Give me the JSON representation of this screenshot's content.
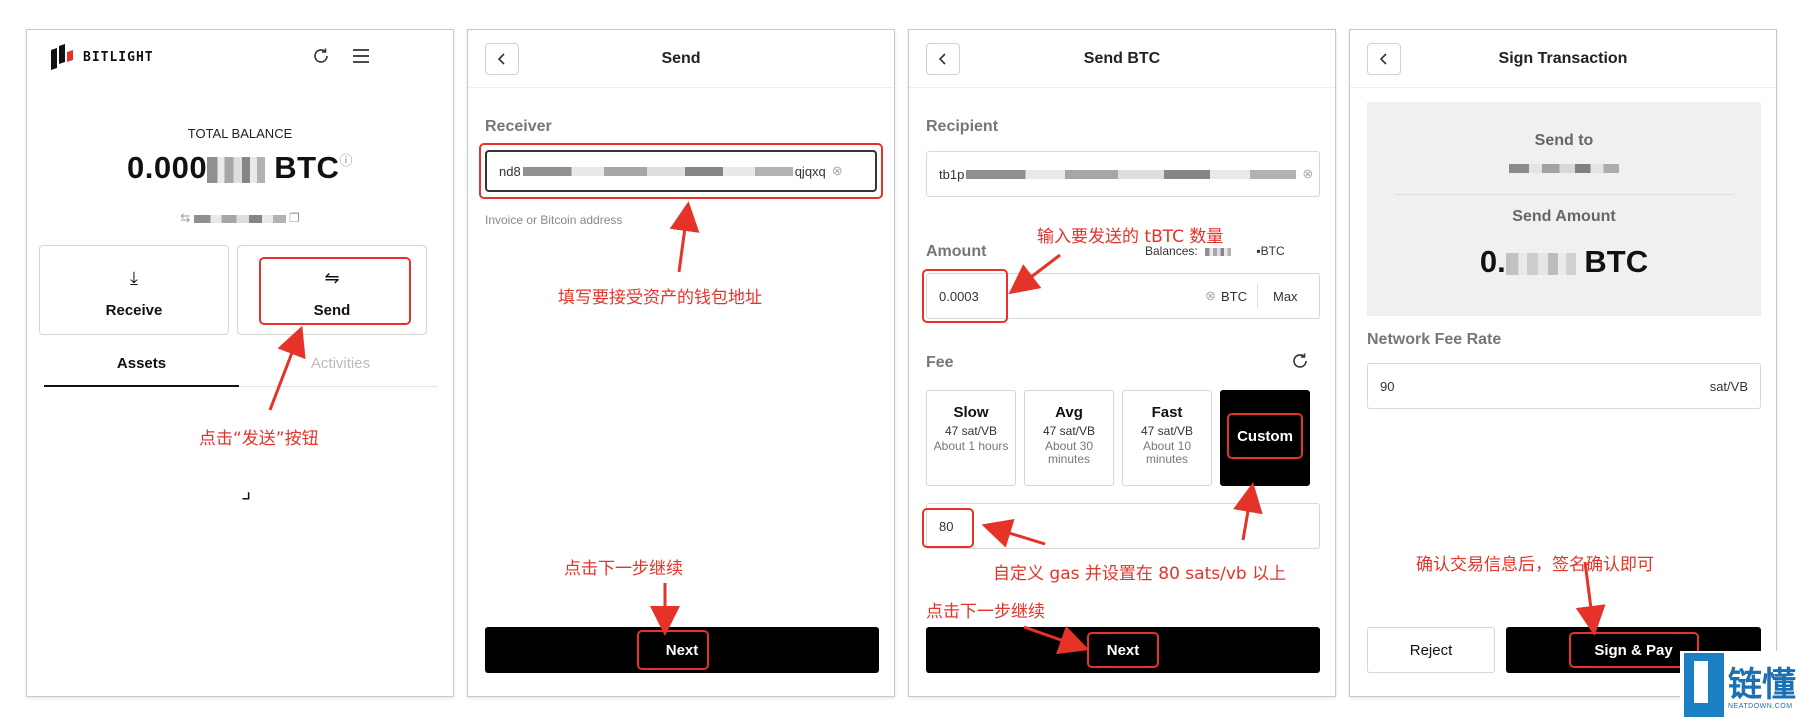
{
  "screen1": {
    "brand": "BITLIGHT",
    "total_label": "TOTAL BALANCE",
    "balance_prefix": "0.000",
    "balance_unit": "BTC",
    "receive_label": "Receive",
    "send_label": "Send",
    "tab_assets": "Assets",
    "tab_activities": "Activities",
    "annotation": "点击“发送”按钮"
  },
  "screen2": {
    "title": "Send",
    "receiver_label": "Receiver",
    "receiver_value_start": "nd8",
    "receiver_value_end": "qjqxq",
    "receiver_hint": "Invoice or Bitcoin address",
    "next_label": "Next",
    "annotation_receiver": "填写要接受资产的钱包地址",
    "annotation_next": "点击下一步继续"
  },
  "screen3": {
    "title": "Send BTC",
    "recipient_label": "Recipient",
    "recipient_value_start": "tb1p",
    "amount_label": "Amount",
    "balances_label": "Balances:",
    "balances_unit": "BTC",
    "amount_value": "0.0003",
    "amount_unit": "BTC",
    "max_label": "Max",
    "fee_label": "Fee",
    "fees": [
      {
        "name": "Slow",
        "rate": "47 sat/VB",
        "time": "About 1 hours"
      },
      {
        "name": "Avg",
        "rate": "47 sat/VB",
        "time": "About 30 minutes"
      },
      {
        "name": "Fast",
        "rate": "47 sat/VB",
        "time": "About 10 minutes"
      }
    ],
    "custom_label": "Custom",
    "custom_fee_value": "80",
    "next_label": "Next",
    "annotation_amount": "输入要发送的 tBTC 数量",
    "annotation_gas": "自定义 gas 并设置在 80 sats/vb 以上",
    "annotation_next": "点击下一步继续"
  },
  "screen4": {
    "title": "Sign Transaction",
    "send_to_label": "Send to",
    "send_amount_label": "Send Amount",
    "amount_prefix": "0.",
    "amount_unit": "BTC",
    "fee_rate_label": "Network Fee Rate",
    "fee_rate_value": "90",
    "fee_rate_unit": "sat/VB",
    "reject_label": "Reject",
    "sign_label": "Sign & Pay",
    "annotation": "确认交易信息后，签名确认即可"
  },
  "watermark": {
    "text": "链懂",
    "sub": "NEATDOWN.COM"
  },
  "colors": {
    "annotation_red": "#e5332a",
    "primary_button": "#000000",
    "watermark_blue": "#1b6fb3"
  }
}
